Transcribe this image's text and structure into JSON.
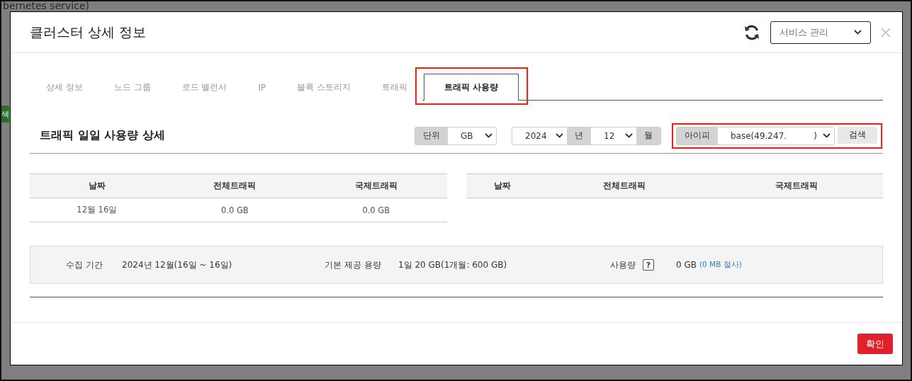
{
  "background": {
    "title": "bernetes service)",
    "button": "색"
  },
  "modal": {
    "title": "클러스터 상세 정보",
    "service_select": "서비스 관리"
  },
  "tabs": [
    {
      "label": "상세 정보",
      "selected": false,
      "highlighted": false
    },
    {
      "label": "노드 그룹",
      "selected": false,
      "highlighted": false
    },
    {
      "label": "로드 밸런서",
      "selected": false,
      "highlighted": false
    },
    {
      "label": "IP",
      "selected": false,
      "highlighted": false
    },
    {
      "label": "블록 스토리지",
      "selected": false,
      "highlighted": false
    },
    {
      "label": "트래픽",
      "selected": false,
      "highlighted": false
    },
    {
      "label": "트래픽 사용량",
      "selected": true,
      "highlighted": true
    }
  ],
  "section": {
    "title": "트래픽 일일 사용량 상세",
    "unit": {
      "label": "단위",
      "value": "GB"
    },
    "year": {
      "value": "2024",
      "label": "년"
    },
    "month": {
      "value": "12",
      "label": "월"
    },
    "ip": {
      "label": "아이피",
      "value": "base(49.247.          )",
      "highlighted": true
    },
    "search_button": "검색"
  },
  "tables": [
    {
      "columns": [
        "날짜",
        "전체트래픽",
        "국제트래픽"
      ],
      "rows": [
        [
          "12월 16일",
          "0.0 GB",
          "0.0 GB"
        ]
      ]
    },
    {
      "columns": [
        "날짜",
        "전체트래픽",
        "국제트래픽"
      ]
    }
  ],
  "summary": {
    "period": {
      "label": "수집 기간",
      "value": "2024년 12월(16일 ~ 16일)"
    },
    "quota": {
      "label": "기본 제공 용량",
      "value": "1일 20 GB(1개월: 600 GB)"
    },
    "usage": {
      "label": "사용량",
      "help": "?",
      "value": "0 GB",
      "detail": "(0 MB 절사)"
    }
  },
  "footer": {
    "confirm": "확인"
  }
}
